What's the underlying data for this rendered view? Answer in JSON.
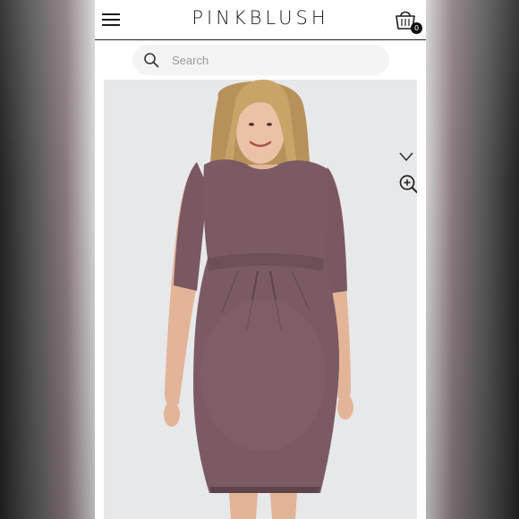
{
  "header": {
    "brand": "PINKBLUSH",
    "cart_count": "0"
  },
  "search": {
    "placeholder": "Search"
  },
  "icons": {
    "menu": "hamburger-menu-icon",
    "cart": "shopping-bag-icon",
    "search": "search-icon",
    "wishlist": "heart-icon",
    "zoom": "zoom-in-icon"
  },
  "colors": {
    "dress": "#7b5a63",
    "background": "#e8e9ea",
    "text": "#1a1a1a"
  }
}
